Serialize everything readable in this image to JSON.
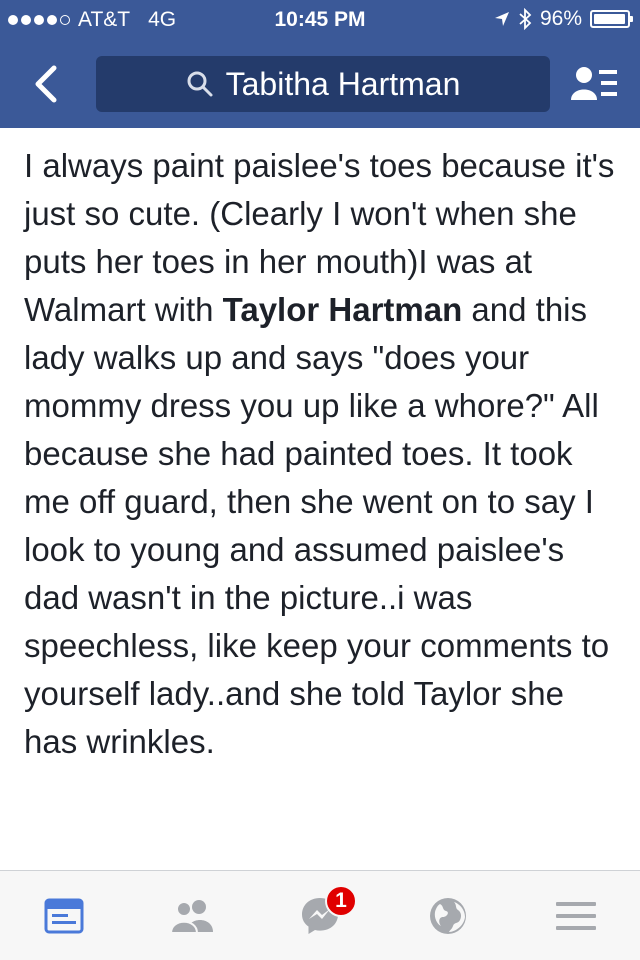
{
  "status_bar": {
    "carrier": "AT&T",
    "network": "4G",
    "time": "10:45 PM",
    "battery_percent": "96%",
    "battery_level": 0.96,
    "signal_bars_filled": 4,
    "signal_bars_total": 5
  },
  "nav": {
    "search_query": "Tabitha Hartman",
    "back_icon": "chevron-left-icon",
    "search_icon": "search-icon",
    "friends_icon": "friend-list-icon",
    "bar_color": "#3b5998"
  },
  "post": {
    "text_before": "I always paint paislee's toes because it's just so cute. (Clearly I won't when she puts her toes in her mouth)I  was at Walmart with ",
    "tagged_name": "Taylor Hartman",
    "text_after": " and this lady walks up and says \"does your mommy dress you up like a whore?\" All because she had painted toes. It took me off guard, then she went on to say I look to young and assumed paislee's dad wasn't in the picture..i was speechless, like keep your comments to yourself lady..and she told Taylor she has wrinkles."
  },
  "tab_bar": {
    "tabs": [
      {
        "icon": "news-feed-icon",
        "active": true
      },
      {
        "icon": "friends-icon",
        "active": false
      },
      {
        "icon": "messenger-icon",
        "active": false,
        "badge": "1"
      },
      {
        "icon": "globe-notifications-icon",
        "active": false
      },
      {
        "icon": "menu-icon",
        "active": false
      }
    ],
    "active_color": "#4a79d9",
    "inactive_color": "#a6a9ae",
    "badge_color": "#e00000"
  }
}
